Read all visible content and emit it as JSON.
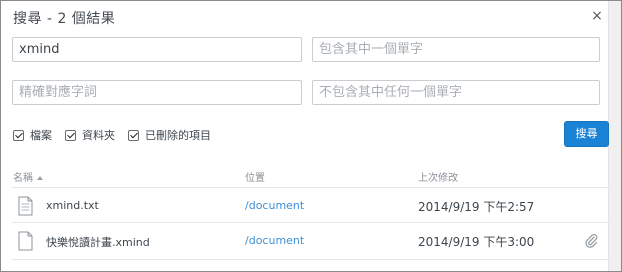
{
  "dialog": {
    "title": "搜尋 - 2 個結果",
    "close_glyph": "×"
  },
  "fields": {
    "any_words_value": "xmind",
    "all_words_placeholder": "包含其中一個單字",
    "exact_phrase_placeholder": "精確對應字詞",
    "exclude_words_placeholder": "不包含其中任何一個單字"
  },
  "filters": [
    {
      "label": "檔案",
      "checked": true
    },
    {
      "label": "資料夾",
      "checked": true
    },
    {
      "label": "已刪除的項目",
      "checked": true
    }
  ],
  "search_button": "搜尋",
  "columns": {
    "name": "名稱",
    "location": "位置",
    "modified": "上次修改"
  },
  "results": [
    {
      "name": "xmind.txt",
      "location": "/document",
      "modified": "2014/9/19 下午2:57",
      "attachment": false
    },
    {
      "name": "快樂悅讀計畫.xmind",
      "location": "/document",
      "modified": "2014/9/19 下午3:00",
      "attachment": true
    }
  ]
}
